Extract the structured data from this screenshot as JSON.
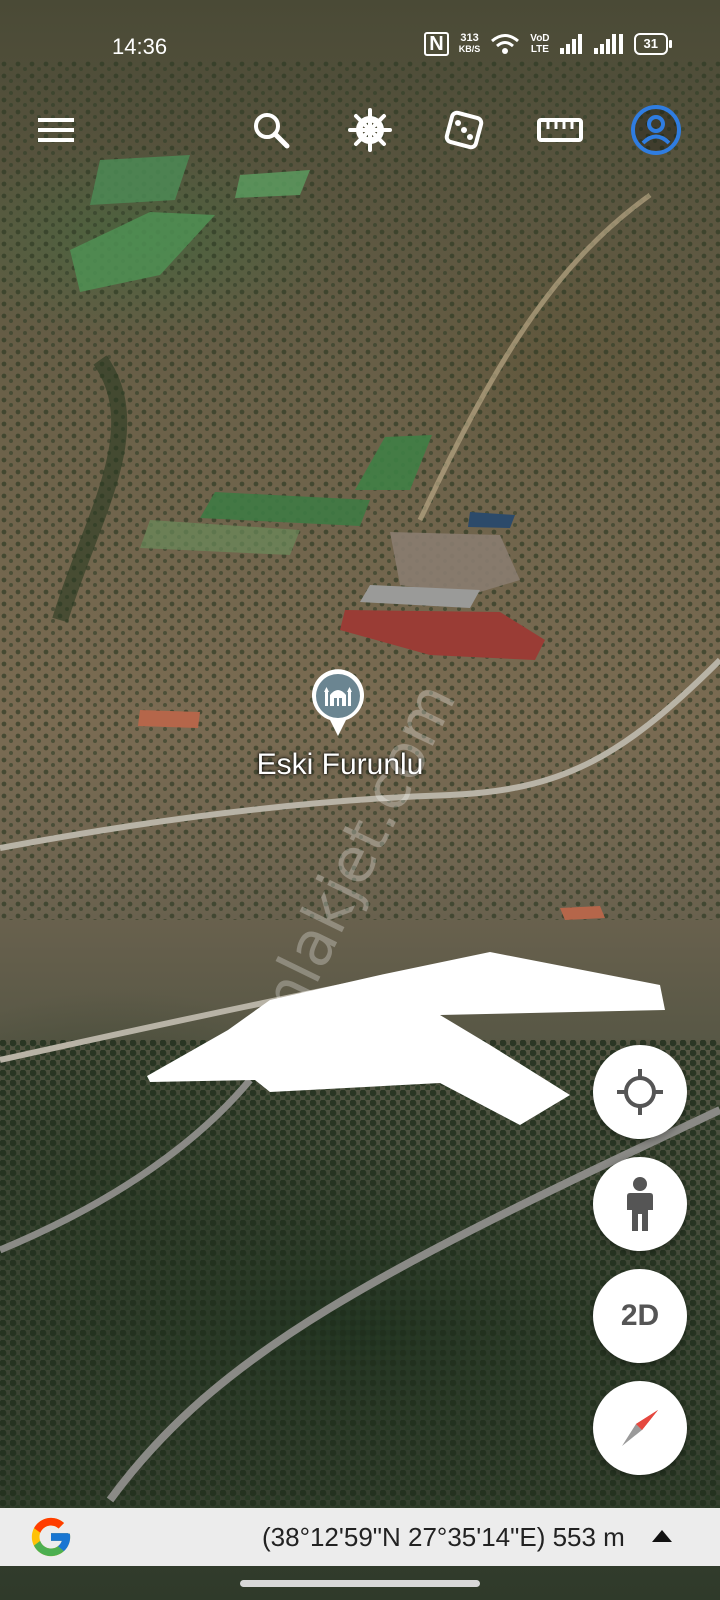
{
  "status_bar": {
    "time": "14:36",
    "net_speed_value": "313",
    "net_speed_unit": "KB/S",
    "network_label_1": "VoD",
    "network_label_2": "LTE",
    "battery": "31",
    "icons": [
      "nfc-icon",
      "wifi-icon",
      "signal-icon",
      "signal-icon",
      "battery-icon"
    ]
  },
  "toolbar": {
    "icons": [
      "menu-icon",
      "search-icon",
      "voyager-wheel-icon",
      "dice-icon",
      "ruler-icon",
      "account-icon"
    ],
    "accent_color": "#2f7de1"
  },
  "map": {
    "place_name": "Eski Furunlu",
    "watermark": "emlakjet.com"
  },
  "controls": {
    "locate_icon": "crosshair-icon",
    "pegman_icon": "pegman-icon",
    "view_mode": "2D",
    "compass_icon": "compass-icon"
  },
  "bottom_bar": {
    "coordinates": "(38°12'59\"N 27°35'14\"E) 553 m",
    "logo": "google-g-logo"
  }
}
